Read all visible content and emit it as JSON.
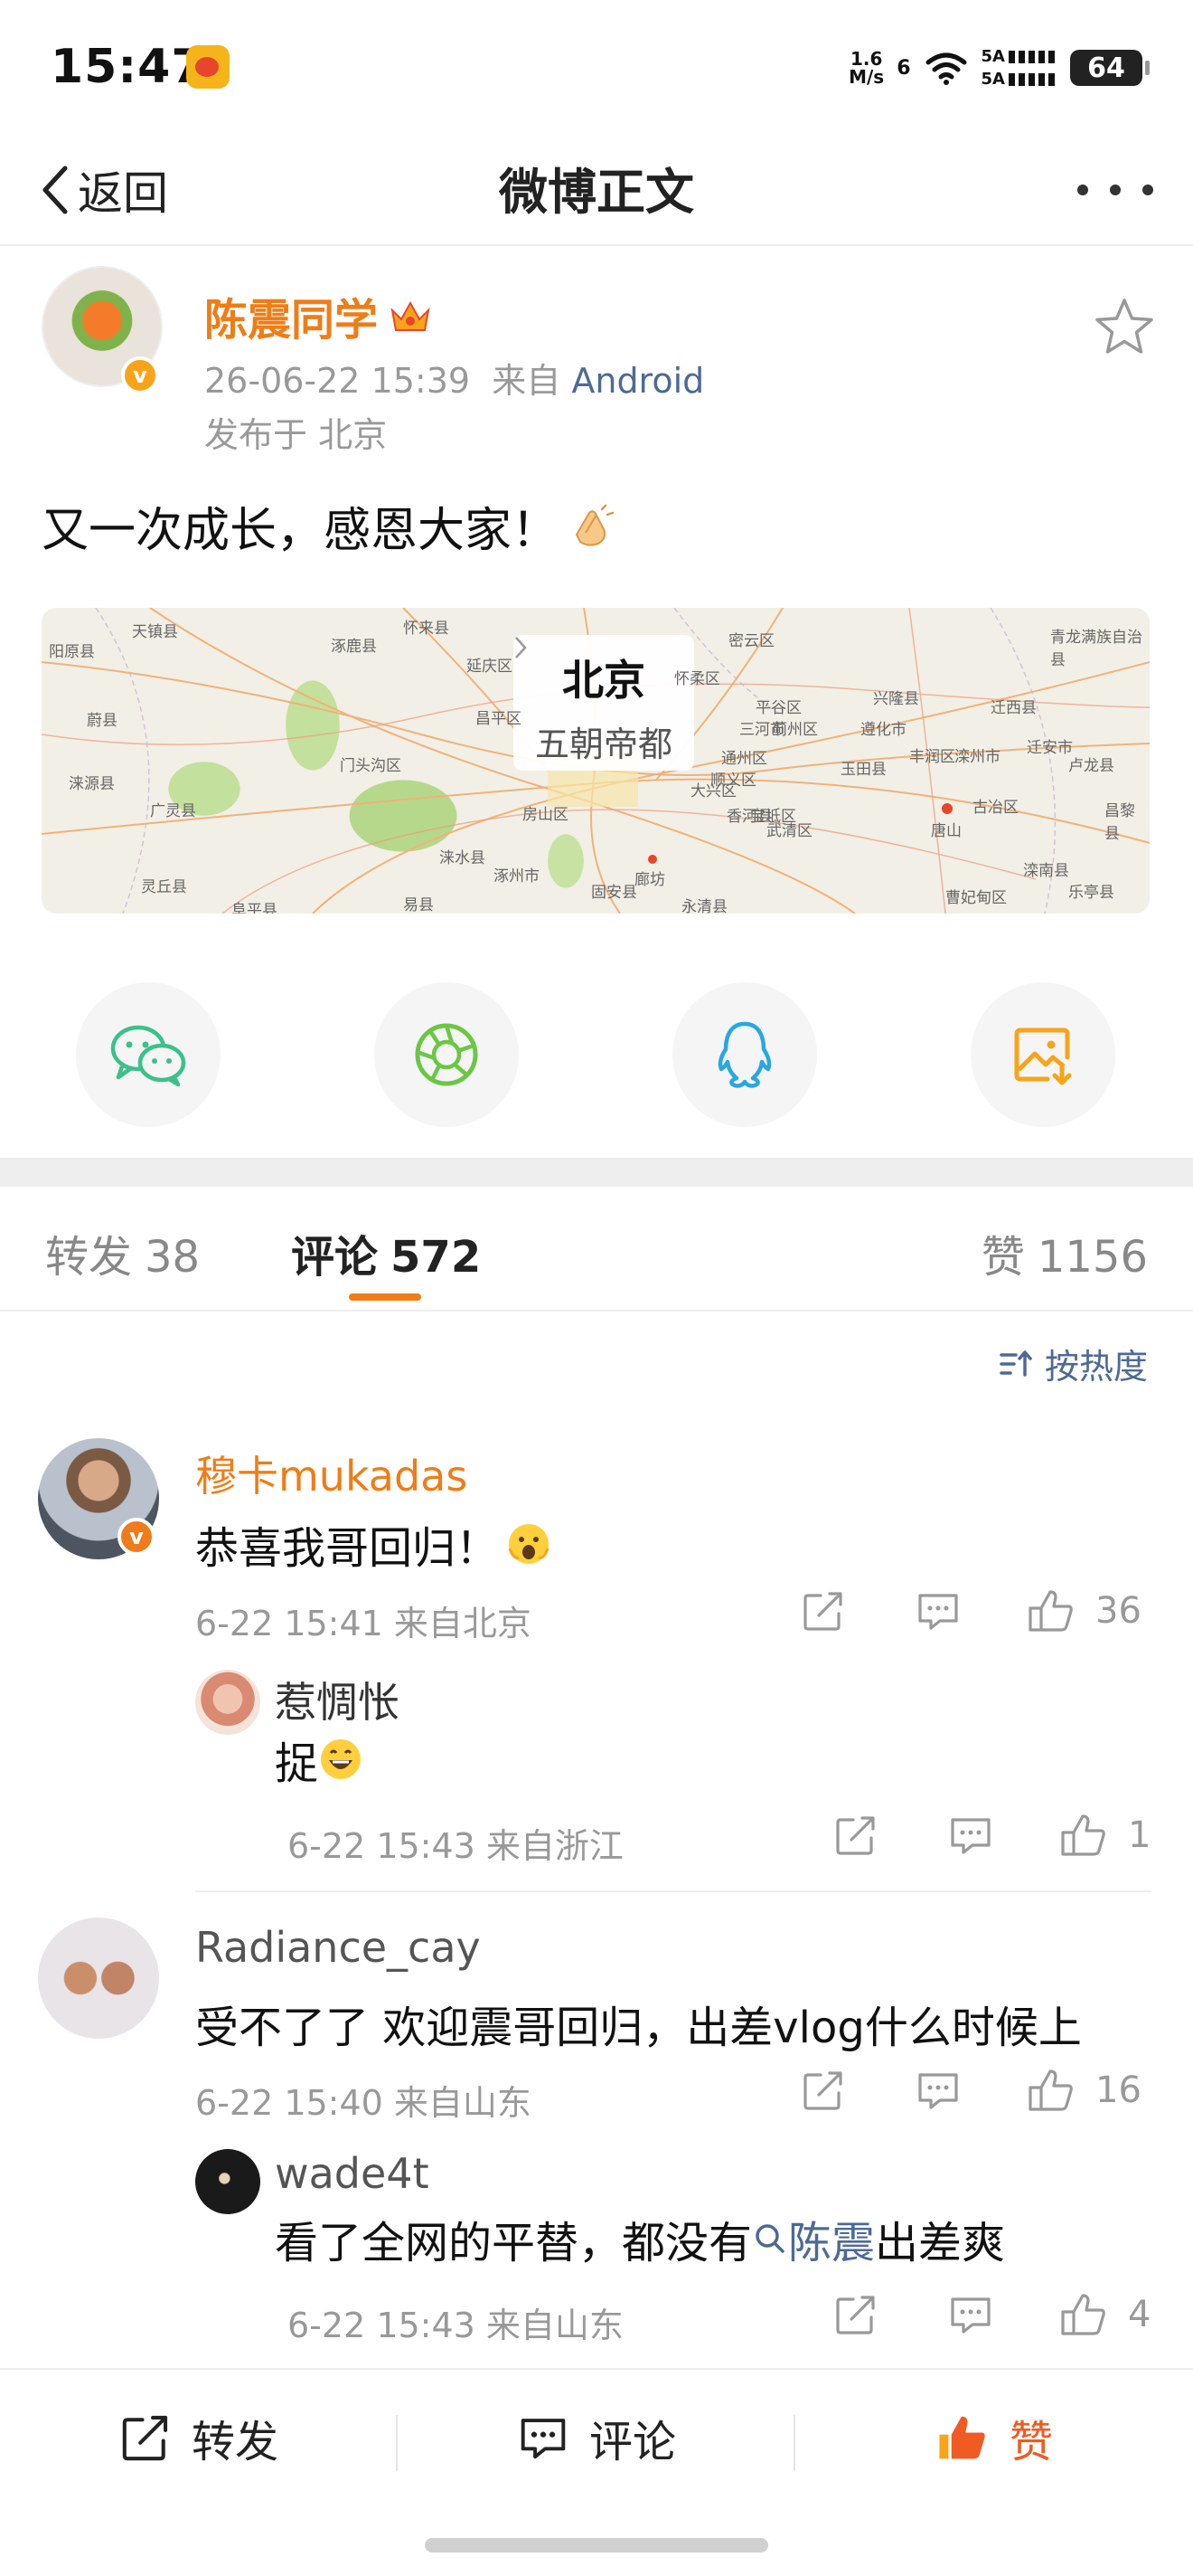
{
  "status_bar": {
    "time": "15:47",
    "net_speed_value": "1.6",
    "net_speed_unit": "M/s",
    "network_type": "6",
    "sim1_label": "5A",
    "sim2_label": "5A",
    "battery": "64"
  },
  "nav": {
    "back_label": "返回",
    "title": "微博正文"
  },
  "post": {
    "username": "陈震同学",
    "time": "26-06-22 15:39",
    "source_prefix": "来自",
    "source": "Android",
    "location": "发布于 北京",
    "text": "又一次成长，感恩大家！",
    "map": {
      "city": "北京",
      "subtitle": "五朝帝都",
      "places": [
        "阳原县",
        "天镇县",
        "涿鹿县",
        "怀来县",
        "延庆区",
        "密云区",
        "兴隆县",
        "青龙满族自治县",
        "蔚县",
        "涞源县",
        "易县",
        "涿州市",
        "房山区",
        "大兴区",
        "通州区",
        "廊坊",
        "三河市",
        "玉田县",
        "丰润区",
        "唐山",
        "滦州市",
        "迁西县",
        "迁安市",
        "卢龙县",
        "滦南县",
        "乐亭县",
        "香河县",
        "宝坻区",
        "平谷区",
        "蓟州区",
        "遵化市",
        "顺义区",
        "怀柔区",
        "昌平区",
        "门头沟区",
        "广灵县",
        "灵丘县",
        "阜平县",
        "涞水县",
        "固安县",
        "永清县",
        "武清区",
        "古冶区",
        "昌黎县",
        "曹妃甸区"
      ]
    }
  },
  "share": [
    "wechat-icon",
    "moments-icon",
    "qq-icon",
    "save-image-icon"
  ],
  "tabs": {
    "repost_label": "转发",
    "repost_count": "38",
    "comment_label": "评论",
    "comment_count": "572",
    "like_label": "赞",
    "like_count": "1156"
  },
  "sort_label": "按热度",
  "comments": [
    {
      "user": "穆卡mukadas",
      "text": "恭喜我哥回归！",
      "meta": "6-22 15:41 来自北京",
      "likes": "36",
      "reply": {
        "user": "惹惆怅",
        "text": "捉",
        "meta": "6-22 15:43 来自浙江",
        "likes": "1"
      }
    },
    {
      "user": "Radiance_cay",
      "text": "受不了了 欢迎震哥回归，出差vlog什么时候上",
      "meta": "6-22 15:40 来自山东",
      "likes": "16",
      "reply": {
        "user": "wade4t",
        "text_before": "看了全网的平替，都没有",
        "link": "陈震",
        "text_after": "出差爽",
        "meta": "6-22 15:43 来自山东",
        "likes": "4"
      }
    }
  ],
  "bottom_bar": {
    "repost": "转发",
    "comment": "评论",
    "like": "赞"
  },
  "colors": {
    "accent_orange": "#ef7d17",
    "link_blue": "#4e6a93",
    "like_red": "#f05a23"
  }
}
